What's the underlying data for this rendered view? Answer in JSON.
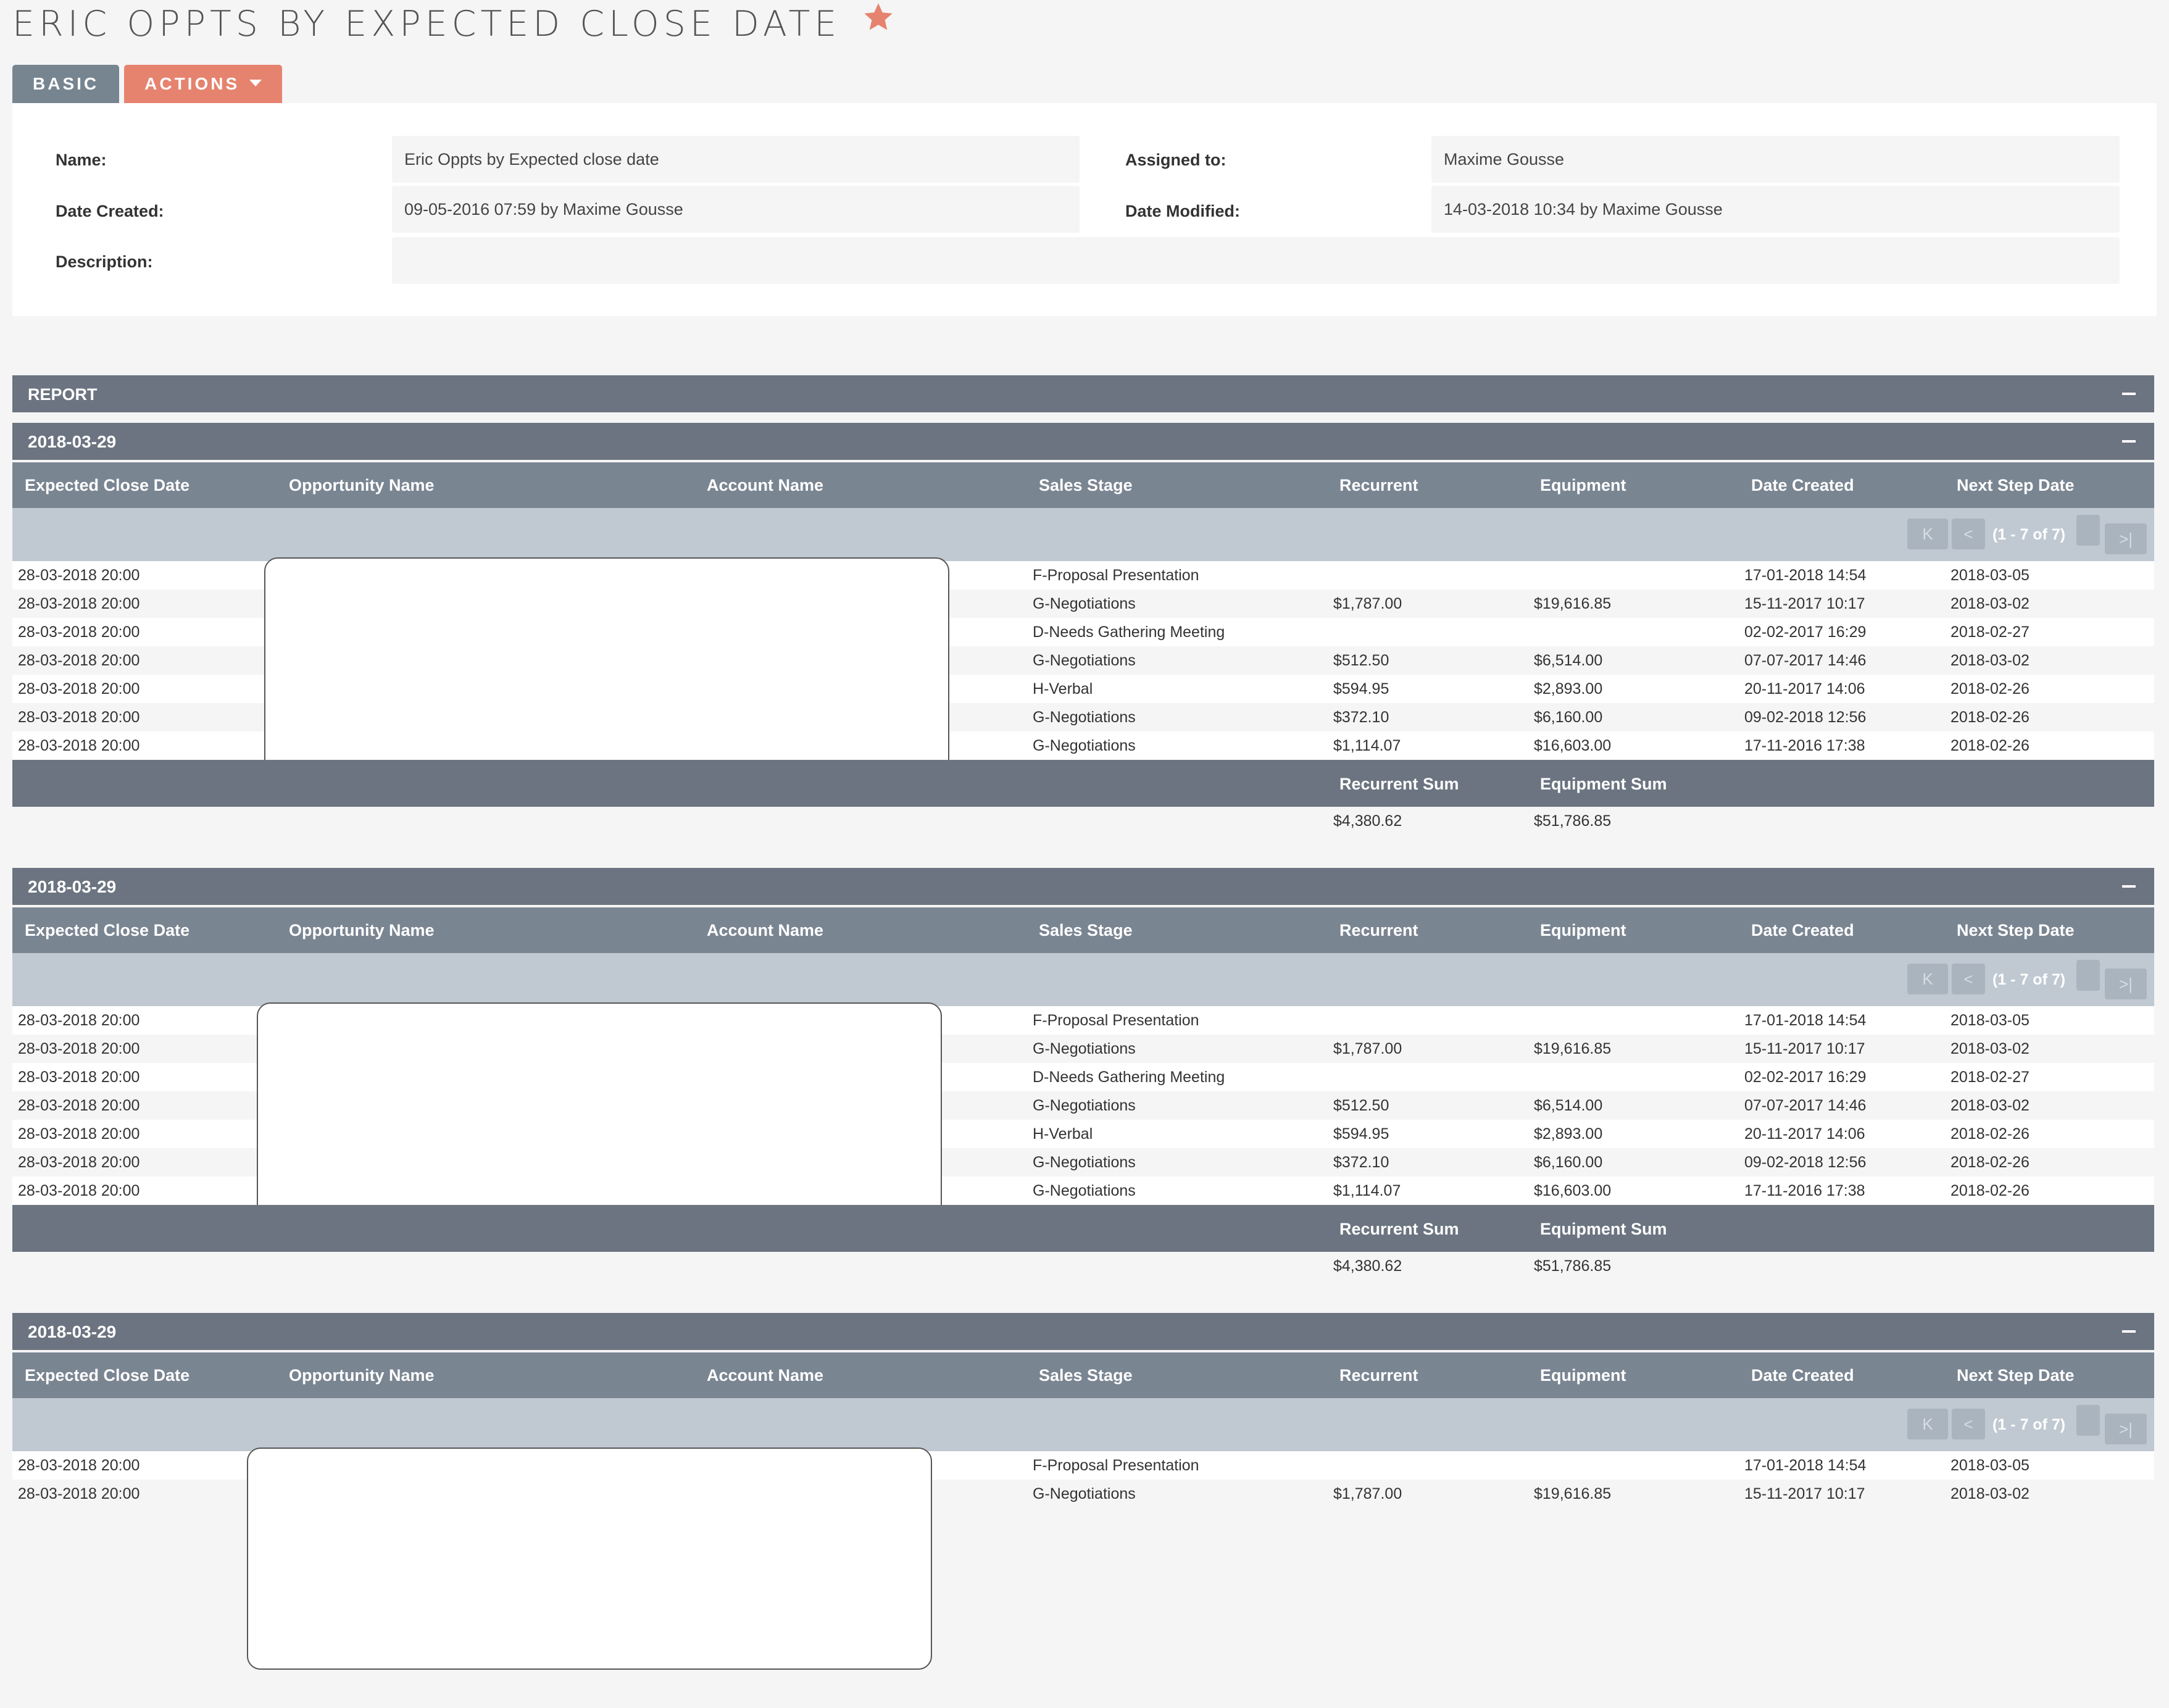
{
  "page": {
    "title": "ERIC OPPTS BY EXPECTED CLOSE DATE",
    "accent": "#e5836f"
  },
  "tabs": {
    "basic": "BASIC",
    "actions": "ACTIONS"
  },
  "details": {
    "name_label": "Name:",
    "name_value": "Eric Oppts by Expected close date",
    "assigned_label": "Assigned to:",
    "assigned_value": "Maxime Gousse",
    "created_label": "Date Created:",
    "created_value": "09-05-2016 07:59 by Maxime Gousse",
    "modified_label": "Date Modified:",
    "modified_value": "14-03-2018 10:34 by Maxime Gousse",
    "description_label": "Description:",
    "description_value": ""
  },
  "report": {
    "label": "REPORT"
  },
  "columns": [
    "Expected Close Date",
    "Opportunity Name",
    "Account Name",
    "Sales Stage",
    "Recurrent",
    "Equipment",
    "Date Created",
    "Next Step Date"
  ],
  "pager": {
    "first": "K",
    "prev": "<",
    "range": "(1 - 7 of 7)",
    "last": ">|"
  },
  "sum_labels": {
    "recurrent": "Recurrent Sum",
    "equipment": "Equipment Sum"
  },
  "groups": [
    {
      "title": "2018-03-29",
      "rows": [
        {
          "close": "28-03-2018 20:00",
          "stage": "F-Proposal Presentation",
          "recurrent": "",
          "equipment": "",
          "created": "17-01-2018 14:54",
          "next": "2018-03-05"
        },
        {
          "close": "28-03-2018 20:00",
          "stage": "G-Negotiations",
          "recurrent": "$1,787.00",
          "equipment": "$19,616.85",
          "created": "15-11-2017 10:17",
          "next": "2018-03-02"
        },
        {
          "close": "28-03-2018 20:00",
          "stage": "D-Needs Gathering Meeting",
          "recurrent": "",
          "equipment": "",
          "created": "02-02-2017 16:29",
          "next": "2018-02-27"
        },
        {
          "close": "28-03-2018 20:00",
          "stage": "G-Negotiations",
          "recurrent": "$512.50",
          "equipment": "$6,514.00",
          "created": "07-07-2017 14:46",
          "next": "2018-03-02"
        },
        {
          "close": "28-03-2018 20:00",
          "stage": "H-Verbal",
          "recurrent": "$594.95",
          "equipment": "$2,893.00",
          "created": "20-11-2017 14:06",
          "next": "2018-02-26"
        },
        {
          "close": "28-03-2018 20:00",
          "stage": "G-Negotiations",
          "recurrent": "$372.10",
          "equipment": "$6,160.00",
          "created": "09-02-2018 12:56",
          "next": "2018-02-26"
        },
        {
          "close": "28-03-2018 20:00",
          "stage": "G-Negotiations",
          "recurrent": "$1,114.07",
          "equipment": "$16,603.00",
          "created": "17-11-2016 17:38",
          "next": "2018-02-26"
        }
      ],
      "sums": {
        "recurrent": "$4,380.62",
        "equipment": "$51,786.85"
      }
    },
    {
      "title": "2018-03-29",
      "rows": [
        {
          "close": "28-03-2018 20:00",
          "stage": "F-Proposal Presentation",
          "recurrent": "",
          "equipment": "",
          "created": "17-01-2018 14:54",
          "next": "2018-03-05"
        },
        {
          "close": "28-03-2018 20:00",
          "stage": "G-Negotiations",
          "recurrent": "$1,787.00",
          "equipment": "$19,616.85",
          "created": "15-11-2017 10:17",
          "next": "2018-03-02"
        },
        {
          "close": "28-03-2018 20:00",
          "stage": "D-Needs Gathering Meeting",
          "recurrent": "",
          "equipment": "",
          "created": "02-02-2017 16:29",
          "next": "2018-02-27"
        },
        {
          "close": "28-03-2018 20:00",
          "stage": "G-Negotiations",
          "recurrent": "$512.50",
          "equipment": "$6,514.00",
          "created": "07-07-2017 14:46",
          "next": "2018-03-02"
        },
        {
          "close": "28-03-2018 20:00",
          "stage": "H-Verbal",
          "recurrent": "$594.95",
          "equipment": "$2,893.00",
          "created": "20-11-2017 14:06",
          "next": "2018-02-26"
        },
        {
          "close": "28-03-2018 20:00",
          "stage": "G-Negotiations",
          "recurrent": "$372.10",
          "equipment": "$6,160.00",
          "created": "09-02-2018 12:56",
          "next": "2018-02-26"
        },
        {
          "close": "28-03-2018 20:00",
          "stage": "G-Negotiations",
          "recurrent": "$1,114.07",
          "equipment": "$16,603.00",
          "created": "17-11-2016 17:38",
          "next": "2018-02-26"
        }
      ],
      "sums": {
        "recurrent": "$4,380.62",
        "equipment": "$51,786.85"
      }
    },
    {
      "title": "2018-03-29",
      "rows": [
        {
          "close": "28-03-2018 20:00",
          "stage": "F-Proposal Presentation",
          "recurrent": "",
          "equipment": "",
          "created": "17-01-2018 14:54",
          "next": "2018-03-05"
        },
        {
          "close": "28-03-2018 20:00",
          "stage": "G-Negotiations",
          "recurrent": "$1,787.00",
          "equipment": "$19,616.85",
          "created": "15-11-2017 10:17",
          "next": "2018-03-02"
        }
      ],
      "sums": {
        "recurrent": "",
        "equipment": ""
      }
    }
  ]
}
